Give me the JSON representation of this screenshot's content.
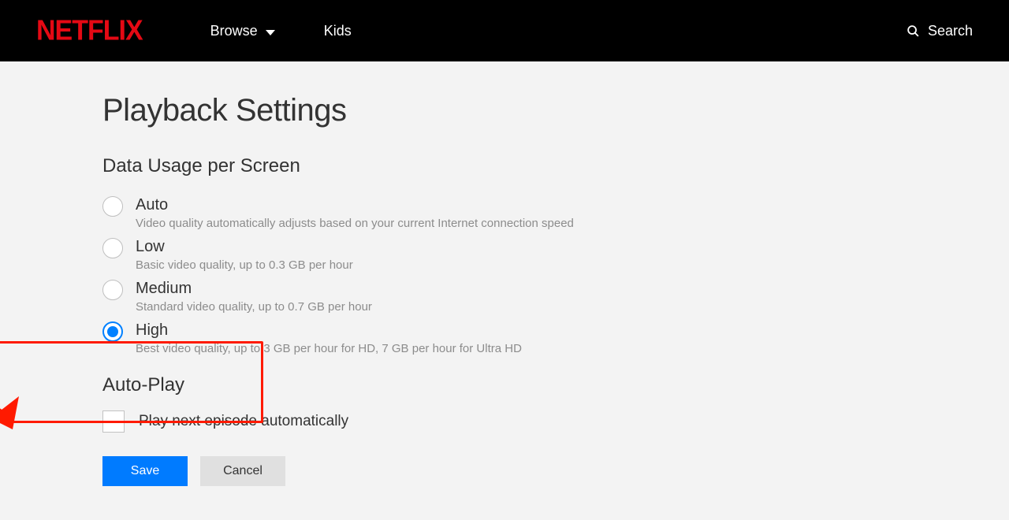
{
  "header": {
    "logo": "NETFLIX",
    "nav": {
      "browse": "Browse",
      "kids": "Kids"
    },
    "search": "Search"
  },
  "main": {
    "title": "Playback Settings",
    "data_usage": {
      "heading": "Data Usage per Screen",
      "options": [
        {
          "label": "Auto",
          "desc": "Video quality automatically adjusts based on your current Internet connection speed",
          "selected": false
        },
        {
          "label": "Low",
          "desc": "Basic video quality, up to 0.3 GB per hour",
          "selected": false
        },
        {
          "label": "Medium",
          "desc": "Standard video quality, up to 0.7 GB per hour",
          "selected": false
        },
        {
          "label": "High",
          "desc": "Best video quality, up to 3 GB per hour for HD, 7 GB per hour for Ultra HD",
          "selected": true
        }
      ]
    },
    "autoplay": {
      "heading": "Auto-Play",
      "checkbox_label": "Play next episode automatically",
      "checked": false
    },
    "buttons": {
      "save": "Save",
      "cancel": "Cancel"
    }
  }
}
